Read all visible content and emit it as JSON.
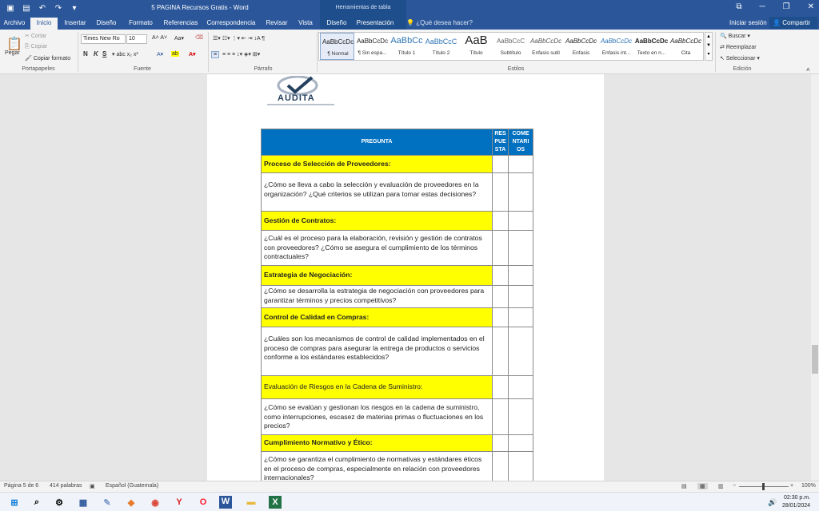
{
  "window": {
    "title": "5 PAGINA  Recursos Gratis - Word",
    "context_tab_header": "Herramientas de tabla",
    "sign_in": "Iniciar sesión",
    "share": "Compartir",
    "tell_me": "¿Qué desea hacer?"
  },
  "tabs": [
    "Archivo",
    "Inicio",
    "Insertar",
    "Diseño",
    "Formato",
    "Referencias",
    "Correspondencia",
    "Revisar",
    "Vista",
    "Diseño",
    "Presentación"
  ],
  "ribbon": {
    "paste": "Pegar",
    "cut": "Cortar",
    "copy": "Copiar",
    "format_painter": "Copiar formato",
    "font_name": "Times New Ro",
    "font_size": "10",
    "groups": {
      "clipboard": "Portapapeles",
      "font": "Fuente",
      "paragraph": "Párrafo",
      "styles": "Estilos",
      "editing": "Edición"
    },
    "styles": [
      {
        "preview": "AaBbCcDc",
        "name": "¶ Normal"
      },
      {
        "preview": "AaBbCcDc",
        "name": "¶ Sin espa..."
      },
      {
        "preview": "AaBbCc",
        "name": "Título 1"
      },
      {
        "preview": "AaBbCcC",
        "name": "Título 2"
      },
      {
        "preview": "AaB",
        "name": "Título"
      },
      {
        "preview": "AaBbCcC",
        "name": "Subtítulo"
      },
      {
        "preview": "AaBbCcDc",
        "name": "Énfasis sutil"
      },
      {
        "preview": "AaBbCcDc",
        "name": "Énfasis"
      },
      {
        "preview": "AaBbCcDc",
        "name": "Énfasis int..."
      },
      {
        "preview": "AaBbCcDc",
        "name": "Texto en n..."
      },
      {
        "preview": "AaBbCcDc",
        "name": "Cita"
      }
    ],
    "find": "Buscar",
    "replace": "Reemplazar",
    "select": "Seleccionar"
  },
  "document": {
    "logo_text": "AUDITA",
    "header": {
      "question": "PREGUNTA",
      "answer": "RES PUE STA",
      "comments": "COME NTARI OS"
    },
    "rows": [
      {
        "type": "section",
        "text": "Proceso de Selección de Proveedores:"
      },
      {
        "type": "question",
        "text": "¿Cómo se lleva a cabo la selección y evaluación de proveedores en la organización? ¿Qué criterios se utilizan para tomar estas decisiones?"
      },
      {
        "type": "section",
        "text": "Gestión de Contratos:"
      },
      {
        "type": "question",
        "text": "¿Cuál es el proceso para la elaboración, revisión y gestión de contratos con proveedores? ¿Cómo se asegura el cumplimiento de los términos contractuales?"
      },
      {
        "type": "section",
        "text": "Estrategia de Negociación:"
      },
      {
        "type": "question",
        "text": "¿Cómo se desarrolla la estrategia de negociación con proveedores para garantizar términos y precios competitivos?"
      },
      {
        "type": "section",
        "text": "Control de Calidad en Compras:"
      },
      {
        "type": "question",
        "text": "¿Cuáles son los mecanismos de control de calidad implementados en el proceso de compras para asegurar la entrega de productos o servicios conforme a los estándares establecidos?"
      },
      {
        "type": "section-normal",
        "text": "Evaluación de Riesgos en la Cadena de Suministro:"
      },
      {
        "type": "question",
        "text": "¿Cómo se evalúan y gestionan los riesgos en la cadena de suministro, como interrupciones, escasez de materias primas o fluctuaciones en los precios?"
      },
      {
        "type": "section",
        "text": "Cumplimiento Normativo y Ético:"
      },
      {
        "type": "question",
        "text": "¿Cómo se garantiza el cumplimiento de normativas y estándares éticos en el proceso de compras, especialmente en relación con proveedores internacionales?"
      }
    ]
  },
  "status": {
    "page": "Página 5 de 6",
    "words": "414 palabras",
    "language": "Español (Guatemala)",
    "zoom": "100%"
  },
  "clock": {
    "time": "02:30 p.m.",
    "date": "28/01/2024"
  },
  "colors": {
    "word_blue": "#2b579a",
    "header_blue": "#0070c0",
    "highlight": "#ffff00"
  }
}
